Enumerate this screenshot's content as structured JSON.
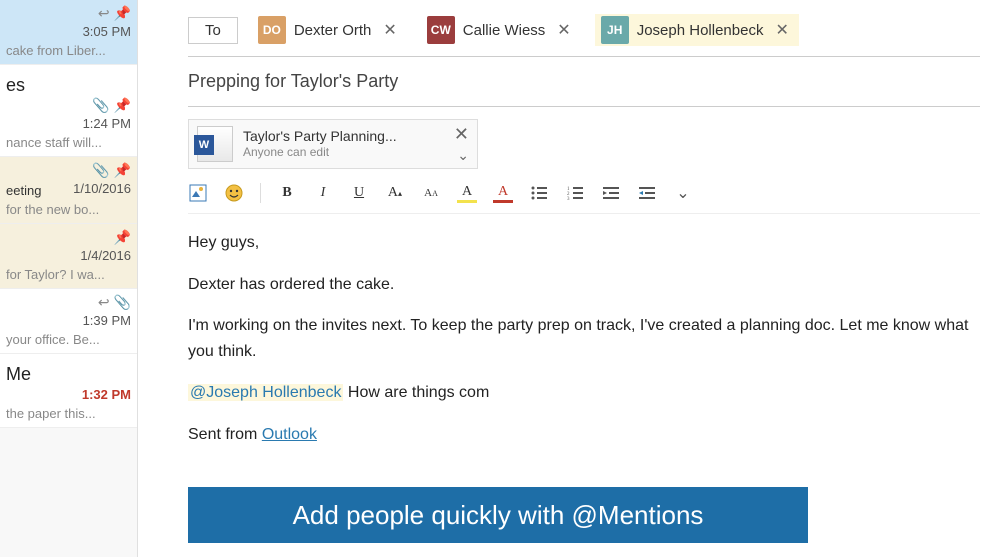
{
  "sidebar": {
    "items": [
      {
        "icons": [
          "reply",
          "pin"
        ],
        "time": "3:05 PM",
        "preview": "cake from Liber...",
        "unread": false,
        "selected": true
      },
      {
        "title": "es",
        "icons": [
          "attach",
          "pin"
        ],
        "time": "1:24 PM",
        "preview": "nance staff will...",
        "unread": false
      },
      {
        "title_left": "eeting",
        "icons": [
          "attach",
          "pin"
        ],
        "time": "1/10/2016",
        "preview": "for the new bo...",
        "unread": true
      },
      {
        "icons": [
          "pin"
        ],
        "time": "1/4/2016",
        "preview": "for Taylor? I wa...",
        "unread": true
      },
      {
        "icons": [
          "reply",
          "attach"
        ],
        "time": "1:39 PM",
        "preview": "your office. Be...",
        "unread": false
      },
      {
        "title": "Me",
        "icons": [],
        "time": "1:32 PM",
        "time_unread": true,
        "preview": "the paper this...",
        "unread": false
      }
    ]
  },
  "compose": {
    "to_label": "To",
    "recipients": [
      {
        "name": "Dexter Orth",
        "avatar_initials": "DO",
        "highlight": false
      },
      {
        "name": "Callie Wiess",
        "avatar_initials": "CW",
        "highlight": false
      },
      {
        "name": "Joseph Hollenbeck",
        "avatar_initials": "JH",
        "highlight": true
      }
    ],
    "subject": "Prepping for Taylor's Party",
    "attachment": {
      "title": "Taylor's Party Planning...",
      "subtitle": "Anyone can edit",
      "icon": "word"
    },
    "toolbar": {
      "image": "image-icon",
      "emoji": "emoji-icon",
      "bold": "B",
      "italic": "I",
      "underline": "U",
      "font_size_up": "A▴",
      "font_size_down": "Aᴀ",
      "highlight": "A",
      "font_color": "A",
      "bullets": "bullets",
      "numbers": "numbers",
      "align": "align",
      "indent": "indent",
      "more": "more"
    },
    "body": {
      "line1": "Hey guys,",
      "line2": "Dexter has ordered the cake.",
      "line3": "I'm working on the invites next. To keep the party prep on track, I've created a planning doc. Let me know what you think.",
      "mention": "@Joseph Hollenbeck",
      "line4_rest": " How are things com",
      "signature_prefix": "Sent from ",
      "signature_link": "Outlook"
    },
    "banner": "Add people quickly with @Mentions"
  }
}
